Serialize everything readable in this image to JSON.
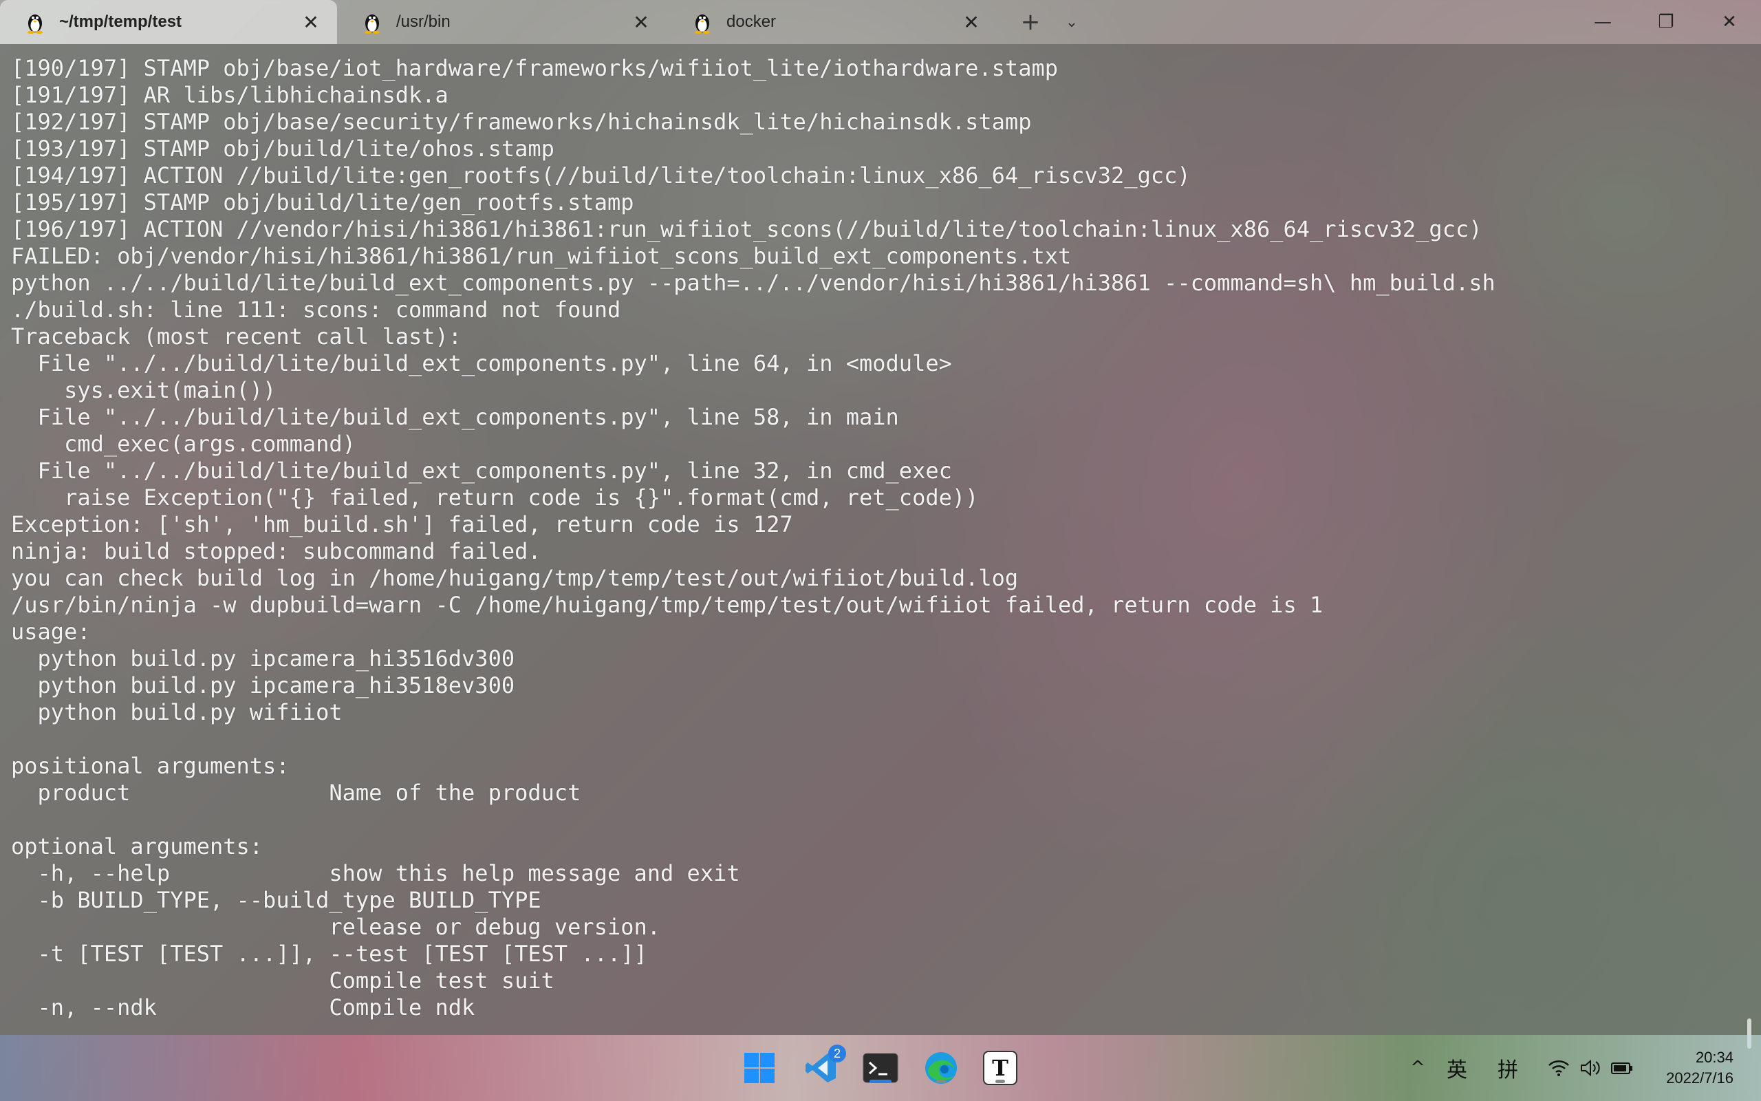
{
  "tabs": [
    {
      "label": "~/tmp/temp/test",
      "icon": "linux-penguin-icon",
      "active": true
    },
    {
      "label": "/usr/bin",
      "icon": "linux-penguin-icon",
      "active": false
    },
    {
      "label": "docker",
      "icon": "linux-penguin-icon",
      "active": false
    }
  ],
  "tab_controls": {
    "new_tab": "+",
    "dropdown": "⌄",
    "close": "✕"
  },
  "window_controls": {
    "minimize": "—",
    "maximize": "❐",
    "close": "✕"
  },
  "terminal": {
    "lines": [
      "[190/197] STAMP obj/base/iot_hardware/frameworks/wifiiot_lite/iothardware.stamp",
      "[191/197] AR libs/libhichainsdk.a",
      "[192/197] STAMP obj/base/security/frameworks/hichainsdk_lite/hichainsdk.stamp",
      "[193/197] STAMP obj/build/lite/ohos.stamp",
      "[194/197] ACTION //build/lite:gen_rootfs(//build/lite/toolchain:linux_x86_64_riscv32_gcc)",
      "[195/197] STAMP obj/build/lite/gen_rootfs.stamp",
      "[196/197] ACTION //vendor/hisi/hi3861/hi3861:run_wifiiot_scons(//build/lite/toolchain:linux_x86_64_riscv32_gcc)",
      "FAILED: obj/vendor/hisi/hi3861/hi3861/run_wifiiot_scons_build_ext_components.txt",
      "python ../../build/lite/build_ext_components.py --path=../../vendor/hisi/hi3861/hi3861 --command=sh\\ hm_build.sh",
      "./build.sh: line 111: scons: command not found",
      "Traceback (most recent call last):",
      "  File \"../../build/lite/build_ext_components.py\", line 64, in <module>",
      "    sys.exit(main())",
      "  File \"../../build/lite/build_ext_components.py\", line 58, in main",
      "    cmd_exec(args.command)",
      "  File \"../../build/lite/build_ext_components.py\", line 32, in cmd_exec",
      "    raise Exception(\"{} failed, return code is {}\".format(cmd, ret_code))",
      "Exception: ['sh', 'hm_build.sh'] failed, return code is 127",
      "ninja: build stopped: subcommand failed.",
      "you can check build log in /home/huigang/tmp/temp/test/out/wifiiot/build.log",
      "/usr/bin/ninja -w dupbuild=warn -C /home/huigang/tmp/temp/test/out/wifiiot failed, return code is 1",
      "usage:",
      "  python build.py ipcamera_hi3516dv300",
      "  python build.py ipcamera_hi3518ev300",
      "  python build.py wifiiot",
      "",
      "positional arguments:",
      "  product               Name of the product",
      "",
      "optional arguments:",
      "  -h, --help            show this help message and exit",
      "  -b BUILD_TYPE, --build_type BUILD_TYPE",
      "                        release or debug version.",
      "  -t [TEST [TEST ...]], --test [TEST [TEST ...]]",
      "                        Compile test suit",
      "  -n, --ndk             Compile ndk"
    ]
  },
  "taskbar": {
    "apps": [
      {
        "name": "start-button",
        "icon": "windows-start-icon"
      },
      {
        "name": "vscode",
        "icon": "vscode-icon",
        "badge": "2"
      },
      {
        "name": "terminal",
        "icon": "terminal-icon",
        "active": true
      },
      {
        "name": "edge",
        "icon": "edge-icon"
      },
      {
        "name": "typora",
        "icon": "typora-icon",
        "label": "T"
      }
    ],
    "tray": {
      "chevron": "^",
      "ime_lang": "英",
      "ime_mode": "拼",
      "time": "20:34",
      "date": "2022/7/16"
    }
  },
  "colors": {
    "accent": "#2a7de1",
    "terminal_text": "#f2f2f2"
  }
}
